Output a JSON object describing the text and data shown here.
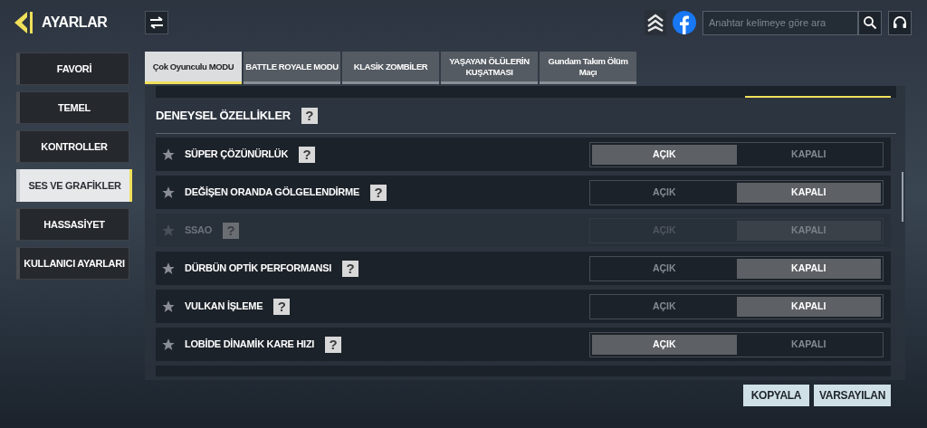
{
  "header": {
    "title": "AYARLAR"
  },
  "search": {
    "placeholder": "Anahtar kelimeye göre ara"
  },
  "sidebar": {
    "items": [
      {
        "label": "FAVORİ",
        "selected": false
      },
      {
        "label": "TEMEL",
        "selected": false
      },
      {
        "label": "KONTROLLER",
        "selected": false
      },
      {
        "label": "SES VE GRAFİKLER",
        "selected": true
      },
      {
        "label": "HASSASİYET",
        "selected": false
      },
      {
        "label": "KULLANICI AYARLARI",
        "selected": false
      }
    ]
  },
  "tabs": [
    {
      "label": "Çok Oyunculu MODU",
      "selected": true
    },
    {
      "label": "BATTLE ROYALE MODU",
      "selected": false
    },
    {
      "label": "KLASİK ZOMBİLER",
      "selected": false
    },
    {
      "label": "YAŞAYAN ÖLÜLERİN KUŞATMASI",
      "selected": false
    },
    {
      "label": "Gundam Takım Ölüm Maçı",
      "selected": false
    }
  ],
  "section": {
    "title": "DENEYSEL ÖZELLİKLER",
    "help": "?"
  },
  "rows": [
    {
      "label": "SÜPER ÇÖZÜNÜRLÜK",
      "help": "?",
      "disabled": false,
      "options": [
        {
          "label": "AÇIK",
          "selected": true
        },
        {
          "label": "KAPALI",
          "selected": false
        }
      ]
    },
    {
      "label": "DEĞİŞEN ORANDA GÖLGELENDİRME",
      "help": "?",
      "disabled": false,
      "options": [
        {
          "label": "AÇIK",
          "selected": false
        },
        {
          "label": "KAPALI",
          "selected": true
        }
      ]
    },
    {
      "label": "SSAO",
      "help": "?",
      "disabled": true,
      "options": [
        {
          "label": "AÇIK",
          "selected": false
        },
        {
          "label": "KAPALI",
          "selected": true
        }
      ]
    },
    {
      "label": "DÜRBÜN OPTİK PERFORMANSI",
      "help": "?",
      "disabled": false,
      "options": [
        {
          "label": "AÇIK",
          "selected": false
        },
        {
          "label": "KAPALI",
          "selected": true
        }
      ]
    },
    {
      "label": "VULKAN İŞLEME",
      "help": "?",
      "disabled": false,
      "options": [
        {
          "label": "AÇIK",
          "selected": false
        },
        {
          "label": "KAPALI",
          "selected": true
        }
      ]
    },
    {
      "label": "LOBİDE DİNAMİK KARE HIZI",
      "help": "?",
      "disabled": false,
      "options": [
        {
          "label": "AÇIK",
          "selected": true
        },
        {
          "label": "KAPALI",
          "selected": false
        }
      ]
    }
  ],
  "buttons": [
    "KOPYALA",
    "VARSAYILAN"
  ]
}
